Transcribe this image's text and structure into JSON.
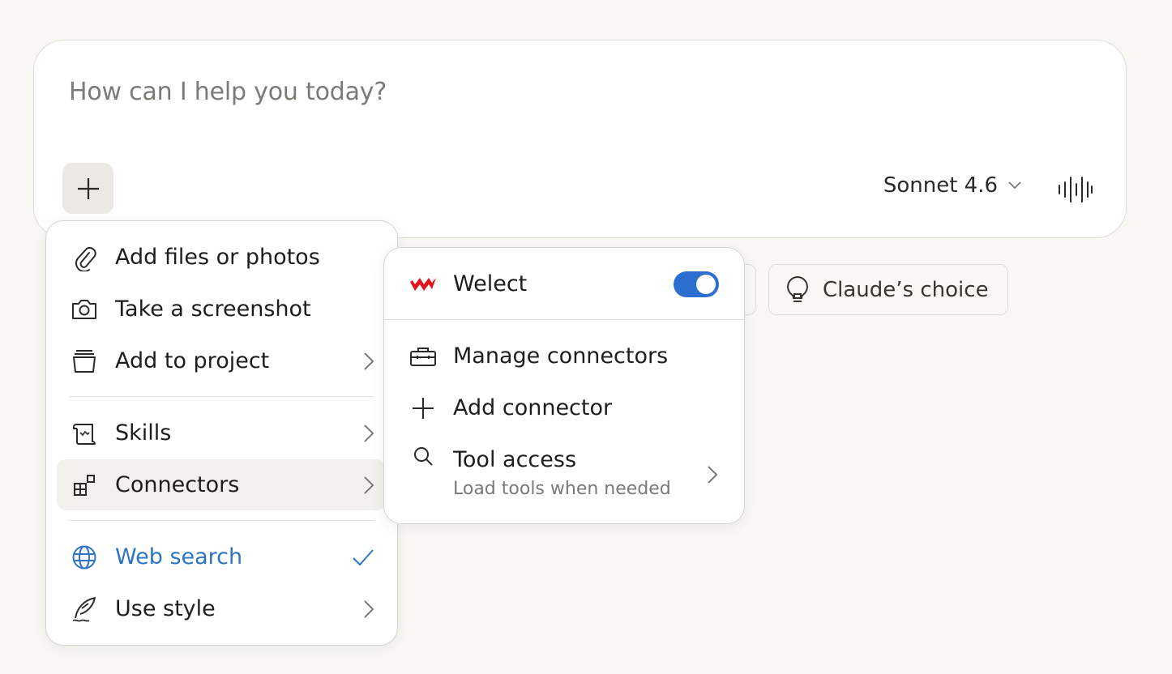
{
  "composer": {
    "placeholder": "How can I help you today?",
    "model_label": "Sonnet 4.6"
  },
  "chips": {
    "claude_choice": "Claude’s choice"
  },
  "menu": {
    "items": [
      {
        "label": "Add files or photos",
        "icon": "paperclip-icon"
      },
      {
        "label": "Take a screenshot",
        "icon": "camera-icon"
      },
      {
        "label": "Add to project",
        "icon": "project-stack-icon",
        "submenu": true
      },
      {
        "label": "Skills",
        "icon": "scroll-icon",
        "submenu": true
      },
      {
        "label": "Connectors",
        "icon": "connectors-icon",
        "submenu": true,
        "active": true
      },
      {
        "label": "Web search",
        "icon": "globe-icon",
        "checked": true
      },
      {
        "label": "Use style",
        "icon": "quill-icon",
        "submenu": true
      }
    ]
  },
  "connectors_menu": {
    "welect": {
      "label": "Welect",
      "enabled": true
    },
    "manage": "Manage connectors",
    "add": "Add connector",
    "tool_access": {
      "label": "Tool access",
      "sub": "Load tools when needed"
    }
  },
  "colors": {
    "accent_blue": "#2c74c5",
    "toggle_on": "#2d6fd0",
    "brand_red": "#e3141c"
  }
}
